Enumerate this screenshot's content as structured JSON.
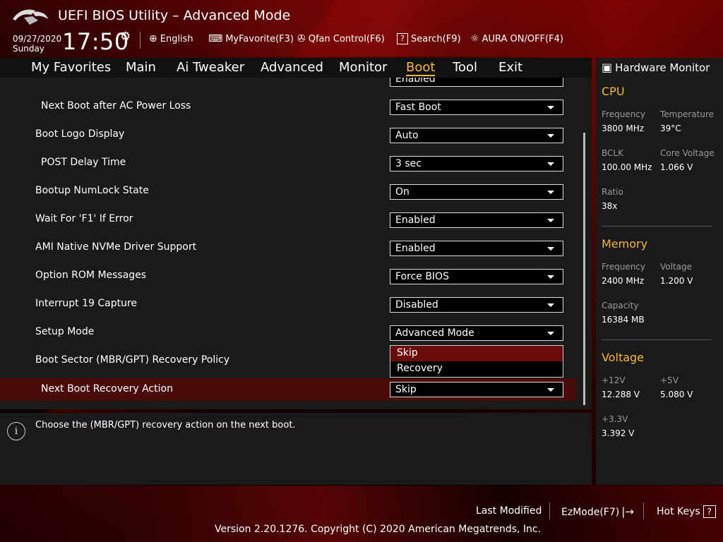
{
  "header": {
    "title": "UEFI BIOS Utility – Advanced Mode",
    "date": "09/27/2020",
    "day": "Sunday",
    "time": "17:50",
    "items": [
      {
        "icon": "globe-icon",
        "glyph": "⊕",
        "label": "English"
      },
      {
        "icon": "keyboard-icon",
        "glyph": "⌨",
        "label": "MyFavorite(F3)"
      },
      {
        "icon": "fan-icon",
        "glyph": "✇",
        "label": "Qfan Control(F6)"
      },
      {
        "icon": "search-box-icon",
        "glyph": "?",
        "label": "Search(F9)"
      },
      {
        "icon": "aura-icon",
        "glyph": "☼",
        "label": "AURA ON/OFF(F4)"
      }
    ]
  },
  "nav": {
    "tabs": [
      "My Favorites",
      "Main",
      "Ai Tweaker",
      "Advanced",
      "Monitor",
      "Boot",
      "Tool",
      "Exit"
    ],
    "active": "Boot"
  },
  "settings": {
    "partial_value": "Enabled",
    "rows": [
      {
        "label": "Next Boot after AC Power Loss",
        "value": "Fast Boot"
      },
      {
        "label": "Boot Logo Display",
        "value": "Auto"
      },
      {
        "label": "POST Delay Time",
        "value": "3 sec"
      },
      {
        "label": "Bootup NumLock State",
        "value": "On"
      },
      {
        "label": "Wait For 'F1' If Error",
        "value": "Enabled"
      },
      {
        "label": "AMI Native NVMe Driver Support",
        "value": "Enabled"
      },
      {
        "label": "Option ROM Messages",
        "value": "Force BIOS"
      },
      {
        "label": "Interrupt 19 Capture",
        "value": "Disabled"
      },
      {
        "label": "Setup Mode",
        "value": "Advanced Mode"
      },
      {
        "label": "Boot Sector (MBR/GPT) Recovery Policy",
        "value": ""
      },
      {
        "label": "Next Boot Recovery Action",
        "value": "Skip"
      }
    ],
    "popup_options": [
      "Skip",
      "Recovery"
    ],
    "popup_selected": "Skip"
  },
  "help": {
    "text": "Choose the (MBR/GPT) recovery action on the next boot."
  },
  "hardware_monitor": {
    "title": "Hardware Monitor",
    "cpu": {
      "heading": "CPU",
      "frequency_label": "Frequency",
      "frequency": "3800 MHz",
      "temperature_label": "Temperature",
      "temperature": "39°C",
      "bclk_label": "BCLK",
      "bclk": "100.00 MHz",
      "core_voltage_label": "Core Voltage",
      "core_voltage": "1.066 V",
      "ratio_label": "Ratio",
      "ratio": "38x"
    },
    "memory": {
      "heading": "Memory",
      "frequency_label": "Frequency",
      "frequency": "2400 MHz",
      "voltage_label": "Voltage",
      "voltage": "1.200 V",
      "capacity_label": "Capacity",
      "capacity": "16384 MB"
    },
    "voltage": {
      "heading": "Voltage",
      "v12_label": "+12V",
      "v12": "12.288 V",
      "v5_label": "+5V",
      "v5": "5.080 V",
      "v33_label": "+3.3V",
      "v33": "3.392 V"
    }
  },
  "footer": {
    "last_modified": "Last Modified",
    "ezmode": "EzMode(F7)",
    "hotkeys": "Hot Keys",
    "hotkeys_glyph": "?",
    "version": "Version 2.20.1276. Copyright (C) 2020 American Megatrends, Inc."
  },
  "colors": {
    "accent": "#f6b73c",
    "selected_row": "#4a0b0b",
    "panel": "#1a1a1a"
  }
}
